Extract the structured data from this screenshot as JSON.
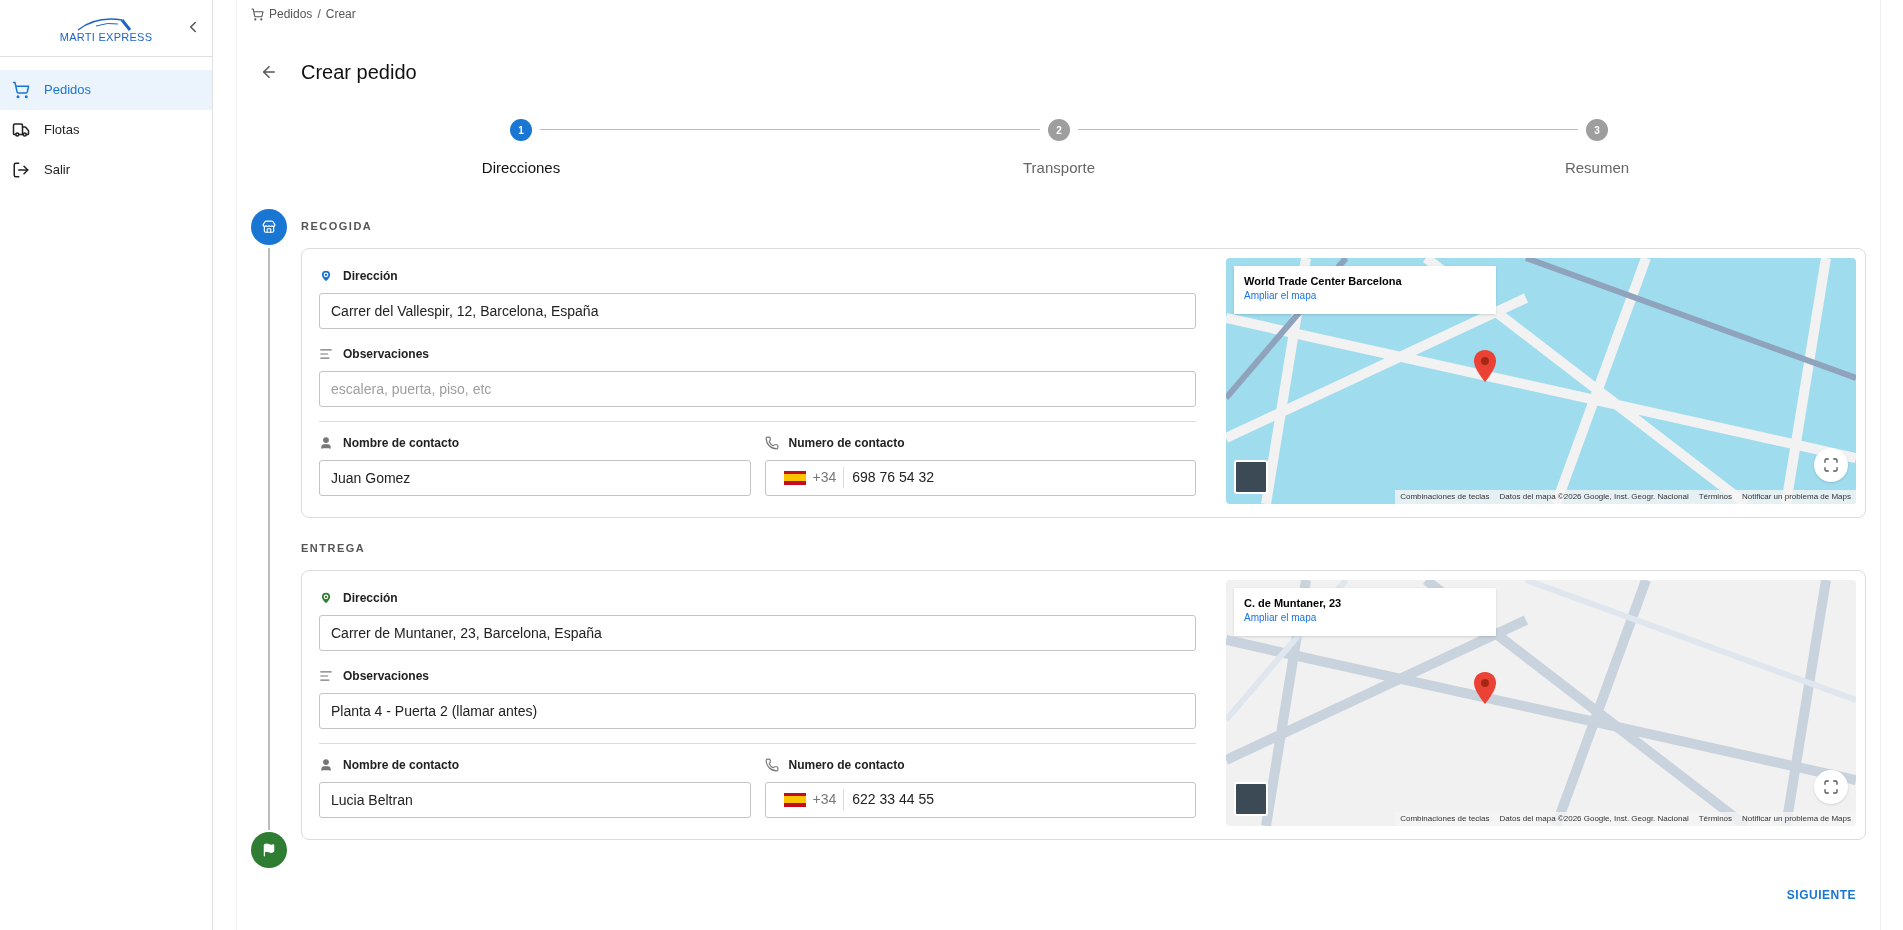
{
  "sidebar": {
    "logo_text": "MARTI EXPRESS",
    "items": [
      {
        "kind": "orders",
        "label": "Pedidos",
        "selected": true
      },
      {
        "kind": "fleet",
        "label": "Flotas",
        "selected": false
      },
      {
        "kind": "logout",
        "label": "Salir",
        "selected": false
      }
    ]
  },
  "breadcrumb": {
    "items": [
      "Pedidos",
      "Crear"
    ],
    "separator": "/"
  },
  "title": "Crear pedido",
  "stepper": [
    {
      "number": "1",
      "label": "Direcciones",
      "selected": true
    },
    {
      "number": "2",
      "label": "Transporte",
      "selected": false
    },
    {
      "number": "3",
      "label": "Resumen",
      "selected": false
    }
  ],
  "sections": [
    {
      "kind": "pickup",
      "heading": "RECOGIDA",
      "address_label": "Dirección",
      "address": "Carrer del Vallespir, 12, Barcelona, España",
      "notes_label": "Observaciones",
      "notes": {
        "placeholder": "escalera, puerta, piso, etc"
      },
      "contact_name_label": "Nombre de contacto",
      "contact_name": "Juan Gomez",
      "phone_label": "Numero de contacto",
      "phone_prefix": "+34",
      "phone": "698 76 54 32",
      "map": {
        "place": "World Trade Center Barcelona",
        "link": "Ampliar el mapa",
        "attribution": [
          "Combinaciones de teclas",
          "Datos del mapa ©2026 Google, Inst. Geogr. Nacional",
          "Términos",
          "Notificar un problema de Maps"
        ]
      }
    },
    {
      "kind": "delivery",
      "heading": "ENTREGA",
      "address_label": "Dirección",
      "address": "Carrer de Muntaner, 23, Barcelona, España",
      "notes_label": "Observaciones",
      "notes": {
        "value": "Planta 4 - Puerta 2 (llamar antes)"
      },
      "contact_name_label": "Nombre de contacto",
      "contact_name": "Lucia Beltran",
      "phone_label": "Numero de contacto",
      "phone_prefix": "+34",
      "phone": "622 33 44 55",
      "map": {
        "place": "C. de Muntaner, 23",
        "link": "Ampliar el mapa",
        "attribution": [
          "Combinaciones de teclas",
          "Datos del mapa ©2026 Google, Inst. Geogr. Nacional",
          "Términos",
          "Notificar un problema de Maps"
        ]
      }
    }
  ],
  "next_button": "SIGUIENTE"
}
